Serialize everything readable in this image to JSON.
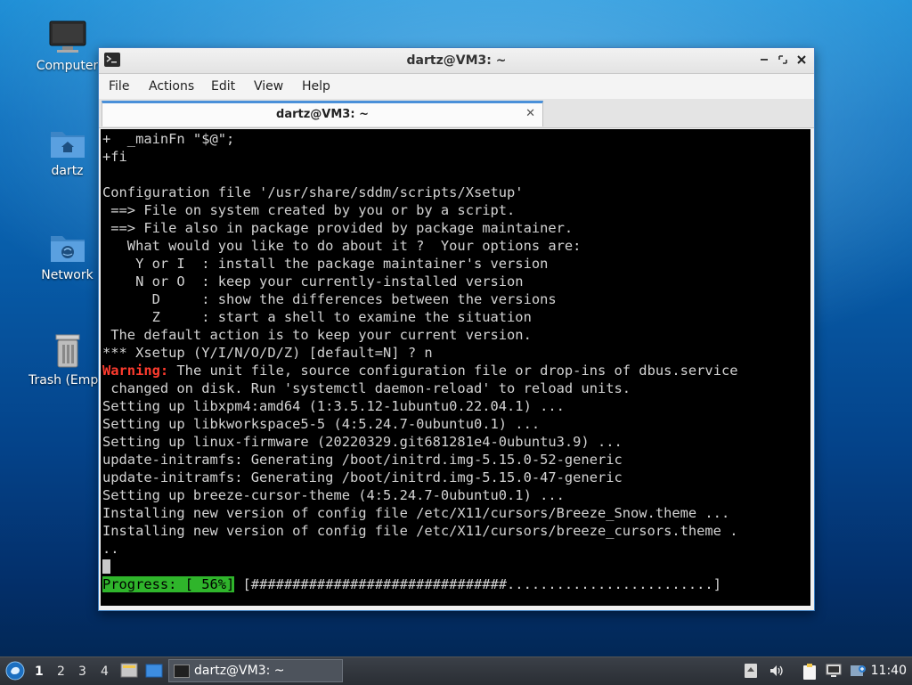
{
  "desktop": {
    "icons": [
      {
        "label": "Computer"
      },
      {
        "label": "dartz"
      },
      {
        "label": "Network"
      },
      {
        "label": "Trash (Empty)"
      }
    ]
  },
  "window": {
    "title": "dartz@VM3: ~",
    "menu": [
      "File",
      "Actions",
      "Edit",
      "View",
      "Help"
    ],
    "tab_title": "dartz@VM3: ~",
    "tab_close": "✕"
  },
  "terminal": {
    "lines": [
      "+  _mainFn \"$@\";",
      "+fi",
      "",
      "Configuration file '/usr/share/sddm/scripts/Xsetup'",
      " ==> File on system created by you or by a script.",
      " ==> File also in package provided by package maintainer.",
      "   What would you like to do about it ?  Your options are:",
      "    Y or I  : install the package maintainer's version",
      "    N or O  : keep your currently-installed version",
      "      D     : show the differences between the versions",
      "      Z     : start a shell to examine the situation",
      " The default action is to keep your current version.",
      "*** Xsetup (Y/I/N/O/D/Z) [default=N] ? n",
      "",
      " changed on disk. Run 'systemctl daemon-reload' to reload units.",
      "Setting up libxpm4:amd64 (1:3.5.12-1ubuntu0.22.04.1) ...",
      "Setting up libkworkspace5-5 (4:5.24.7-0ubuntu0.1) ...",
      "Setting up linux-firmware (20220329.git681281e4-0ubuntu3.9) ...",
      "update-initramfs: Generating /boot/initrd.img-5.15.0-52-generic",
      "update-initramfs: Generating /boot/initrd.img-5.15.0-47-generic",
      "Setting up breeze-cursor-theme (4:5.24.7-0ubuntu0.1) ...",
      "Installing new version of config file /etc/X11/cursors/Breeze_Snow.theme ...",
      "Installing new version of config file /etc/X11/cursors/breeze_cursors.theme .",
      ".."
    ],
    "warning_label": "Warning:",
    "warning_text": " The unit file, source configuration file or drop-ins of dbus.service",
    "progress_label": "Progress: [ 56%]",
    "progress_bar": " [###############################.........................]",
    "progress_percent": 56
  },
  "taskbar": {
    "workspaces": [
      "1",
      "2",
      "3",
      "4"
    ],
    "active_workspace": "1",
    "task_label": "dartz@VM3: ~",
    "clock": "11:40"
  }
}
